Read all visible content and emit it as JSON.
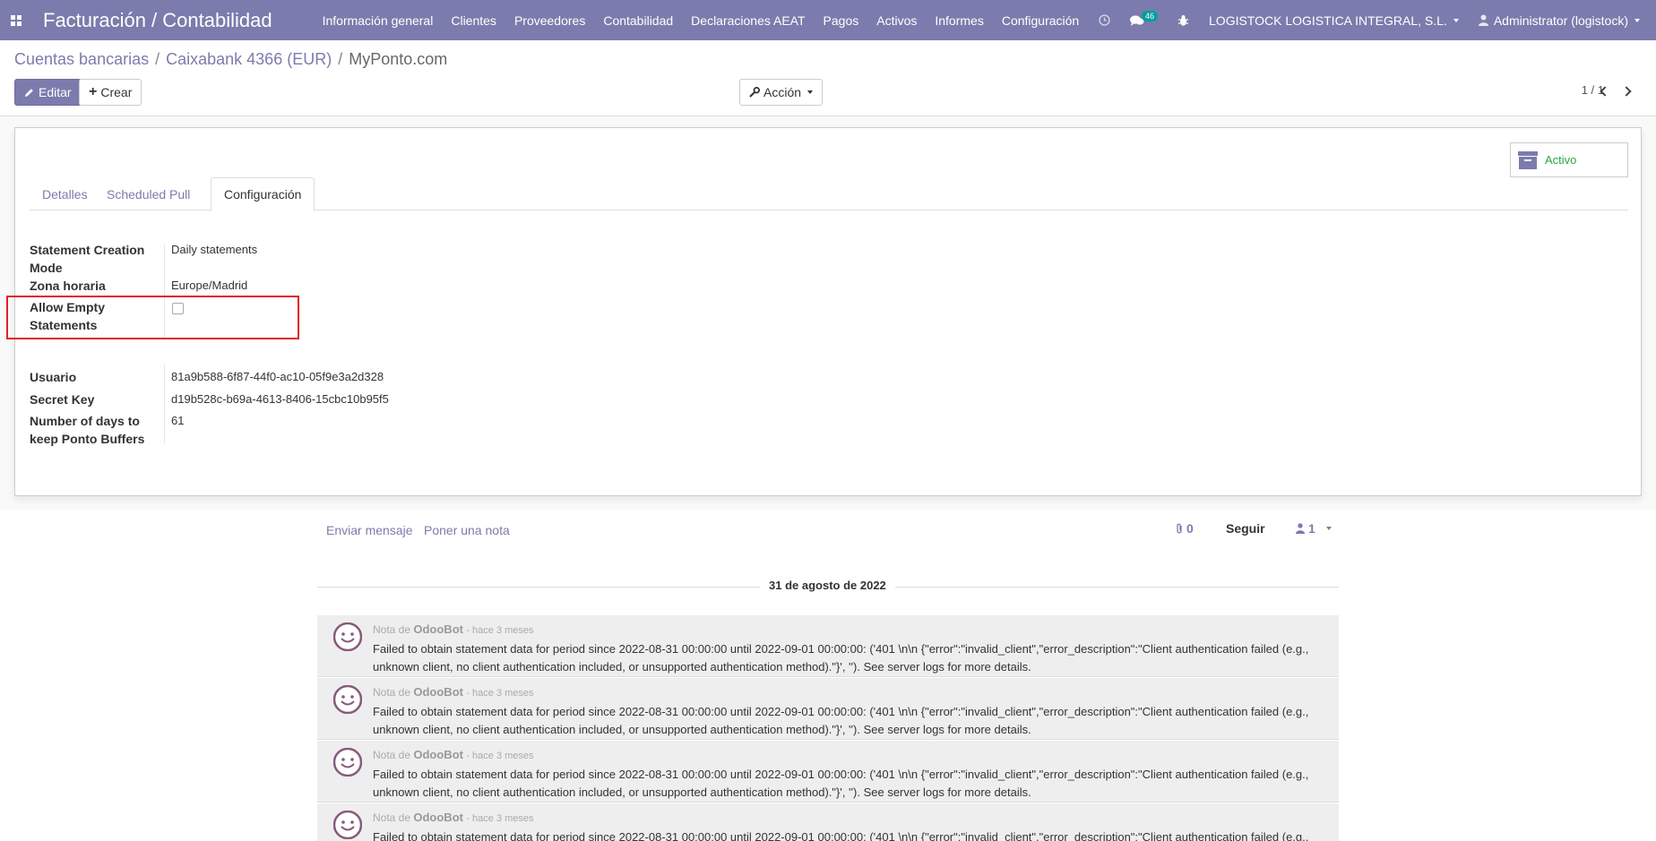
{
  "navbar": {
    "brand": "Facturación / Contabilidad",
    "menu": [
      "Información general",
      "Clientes",
      "Proveedores",
      "Contabilidad",
      "Declaraciones AEAT",
      "Pagos",
      "Activos",
      "Informes",
      "Configuración"
    ],
    "messages_count": "46",
    "company": "LOGISTOCK LOGISTICA INTEGRAL, S.L.",
    "user": "Administrator (logistock)",
    "color": "#7c7bad"
  },
  "breadcrumb": {
    "items": [
      "Cuentas bancarias",
      "Caixabank 4366 (EUR)"
    ],
    "current": "MyPonto.com",
    "separator": "/"
  },
  "toolbar": {
    "edit_label": "Editar",
    "create_label": "Crear",
    "action_label": "Acción",
    "pager": "1 / 1"
  },
  "sheet": {
    "active_label": "Activo",
    "tabs": [
      "Detalles",
      "Scheduled Pull",
      "Configuración"
    ],
    "active_tab": "Configuración",
    "fields": {
      "creation_mode_label": "Statement Creation Mode",
      "creation_mode_value": "Daily statements",
      "timezone_label": "Zona horaria",
      "timezone_value": "Europe/Madrid",
      "allow_empty_label": "Allow Empty Statements",
      "allow_empty_checked": false,
      "user_label": "Usuario",
      "user_value": "81a9b588-6f87-44f0-ac10-05f9e3a2d328",
      "secret_label": "Secret Key",
      "secret_value": "d19b528c-b69a-4613-8406-15cbc10b95f5",
      "buffer_days_label": "Number of days to keep Ponto Buffers",
      "buffer_days_value": "61"
    }
  },
  "chatter": {
    "send_message": "Enviar mensaje",
    "log_note": "Poner una nota",
    "attachments": "0",
    "follow": "Seguir",
    "followers": "1",
    "date_separator": "31 de agosto de 2022",
    "messages": [
      {
        "prefix": "Nota de",
        "author": "OdooBot",
        "ago": "- hace 3 meses",
        "text": "Failed to obtain statement data for period since 2022-08-31 00:00:00 until 2022-09-01 00:00:00: ('401 \\n\\n {\"error\":\"invalid_client\",\"error_description\":\"Client authentication failed (e.g., unknown client, no client authentication included, or unsupported authentication method).\"}', ''). See server logs for more details."
      },
      {
        "prefix": "Nota de",
        "author": "OdooBot",
        "ago": "- hace 3 meses",
        "text": "Failed to obtain statement data for period since 2022-08-31 00:00:00 until 2022-09-01 00:00:00: ('401 \\n\\n {\"error\":\"invalid_client\",\"error_description\":\"Client authentication failed (e.g., unknown client, no client authentication included, or unsupported authentication method).\"}', ''). See server logs for more details."
      },
      {
        "prefix": "Nota de",
        "author": "OdooBot",
        "ago": "- hace 3 meses",
        "text": "Failed to obtain statement data for period since 2022-08-31 00:00:00 until 2022-09-01 00:00:00: ('401 \\n\\n {\"error\":\"invalid_client\",\"error_description\":\"Client authentication failed (e.g., unknown client, no client authentication included, or unsupported authentication method).\"}', ''). See server logs for more details."
      },
      {
        "prefix": "Nota de",
        "author": "OdooBot",
        "ago": "- hace 3 meses",
        "text": "Failed to obtain statement data for period since 2022-08-31 00:00:00 until 2022-09-01 00:00:00: ('401 \\n\\n {\"error\":\"invalid_client\",\"error_description\":\"Client authentication failed (e.g., unknown client, no client authentication included, or unsupported authentication method).\"}', ''). See server logs for more details."
      }
    ]
  }
}
